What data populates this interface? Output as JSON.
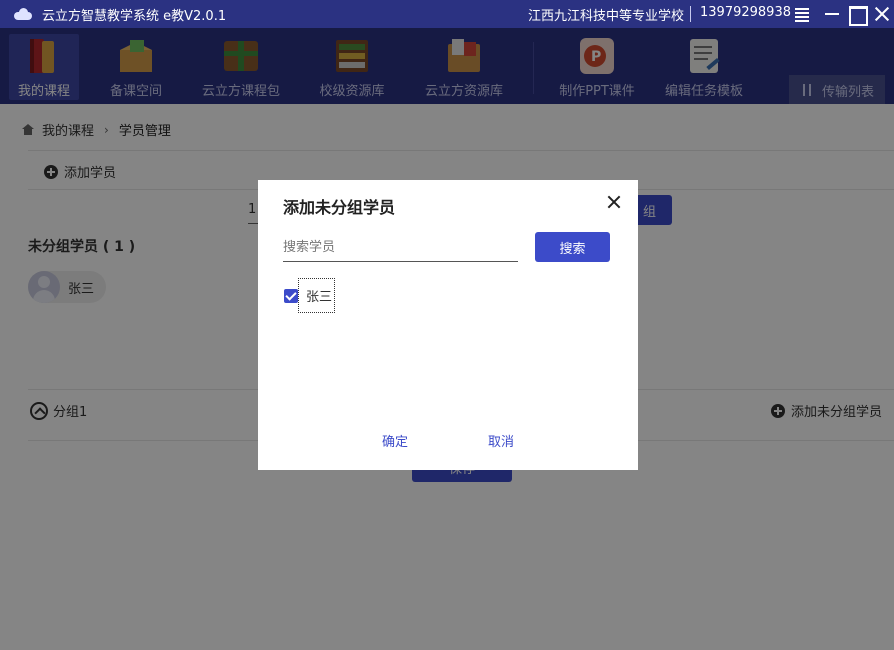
{
  "window": {
    "title": "云立方智慧教学系统 e教V2.0.1",
    "school": "江西九江科技中等专业学校",
    "phone": "13979298938"
  },
  "toolbar": {
    "items": [
      {
        "label": "我的课程",
        "icon": "book-icon",
        "active": true
      },
      {
        "label": "备课空间",
        "icon": "prepare-box-icon",
        "active": false
      },
      {
        "label": "云立方课程包",
        "icon": "course-package-icon",
        "active": false
      },
      {
        "label": "校级资源库",
        "icon": "school-library-icon",
        "active": false
      },
      {
        "label": "云立方资源库",
        "icon": "resource-library-icon",
        "active": false
      },
      {
        "label": "制作PPT课件",
        "icon": "ppt-icon",
        "active": false
      },
      {
        "label": "编辑任务模板",
        "icon": "task-template-icon",
        "active": false
      }
    ],
    "transfer_label": "传输列表"
  },
  "breadcrumb": {
    "home": "我的课程",
    "current": "学员管理"
  },
  "actions": {
    "add_student": "添加学员"
  },
  "group_form": {
    "input_value": "1",
    "create_label": "组"
  },
  "ungrouped": {
    "title": "未分组学员 ( 1 )",
    "students": [
      {
        "name": "张三"
      }
    ]
  },
  "groups": [
    {
      "name": "分组1",
      "add_label": "添加未分组学员"
    }
  ],
  "save_label": "保存",
  "modal": {
    "title": "添加未分组学员",
    "search_placeholder": "搜索学员",
    "search_label": "搜索",
    "students": [
      {
        "name": "张三",
        "checked": true
      }
    ],
    "confirm_label": "确定",
    "cancel_label": "取消"
  },
  "colors": {
    "toolbar_bg": "#2b3282",
    "accent": "#3c4bc9"
  }
}
